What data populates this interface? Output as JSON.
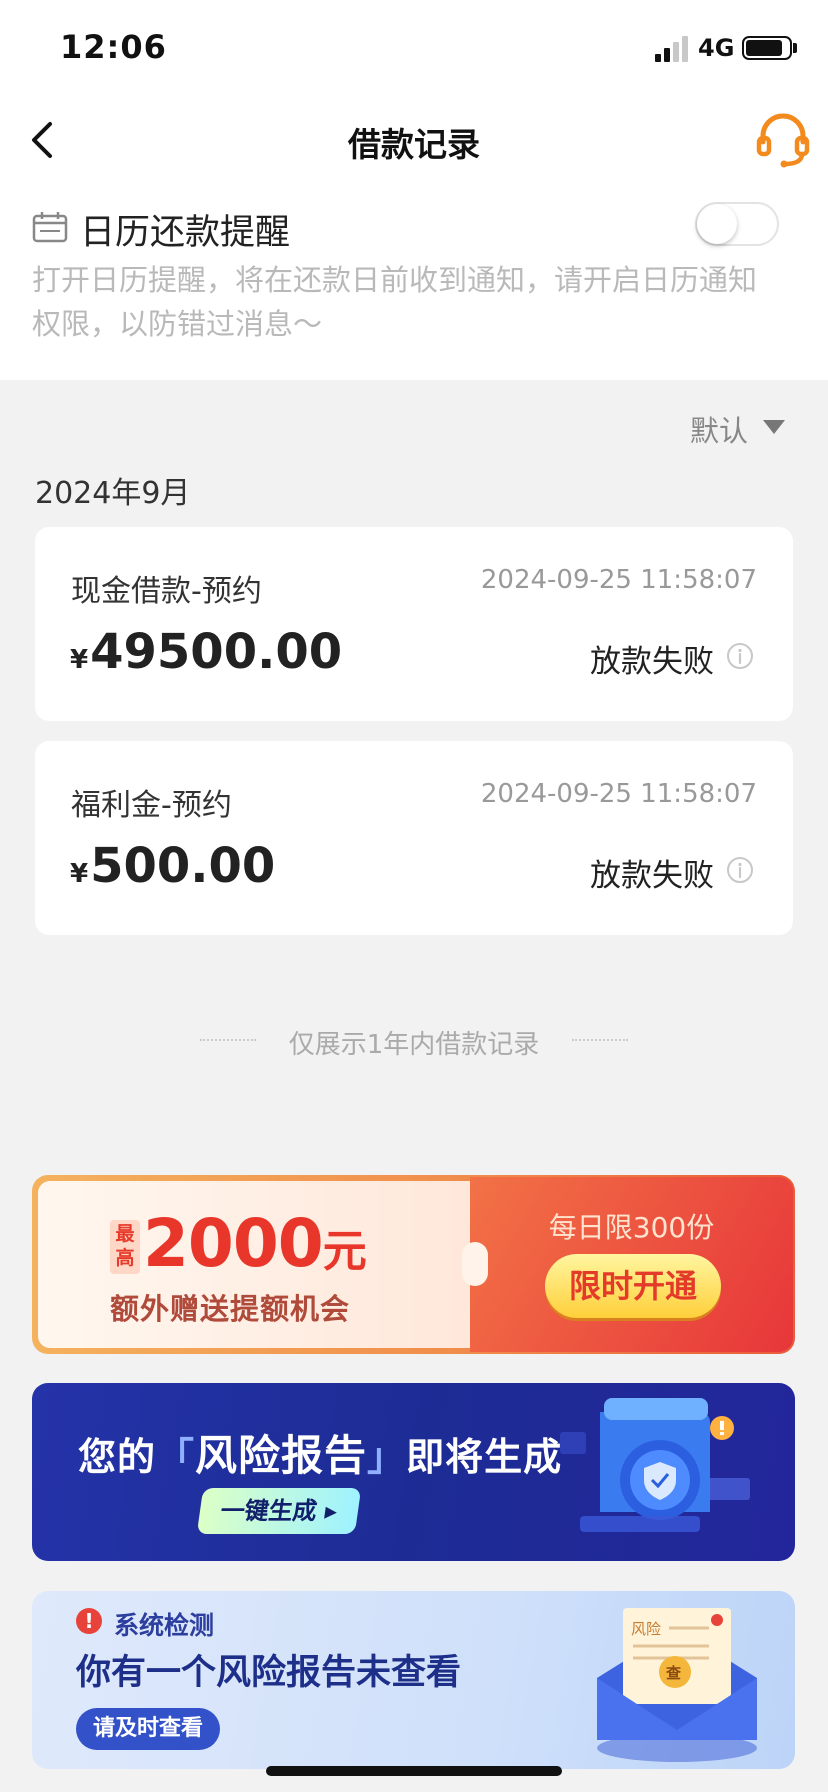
{
  "status_bar": {
    "time": "12:06",
    "network": "4G"
  },
  "header": {
    "title": "借款记录"
  },
  "reminder": {
    "title": "日历还款提醒",
    "description": "打开日历提醒，将在还款日前收到通知，请开启日历通知权限，以防错过消息～",
    "toggle_on": false
  },
  "sort": {
    "label": "默认"
  },
  "month": "2024年9月",
  "records": [
    {
      "name": "现金借款-预约",
      "time": "2024-09-25 11:58:07",
      "currency": "¥",
      "amount": "49500.00",
      "status": "放款失败"
    },
    {
      "name": "福利金-预约",
      "time": "2024-09-25 11:58:07",
      "currency": "¥",
      "amount": "500.00",
      "status": "放款失败"
    }
  ],
  "footer_note": "仅展示1年内借款记录",
  "banner_quota": {
    "tag": "最高",
    "amount": "2000",
    "unit": "元",
    "subtitle": "额外赠送提额机会",
    "limit": "每日限300份",
    "button": "限时开通"
  },
  "banner_report": {
    "title_prefix": "您的",
    "title_highlight": "风险报告",
    "title_suffix": "即将生成",
    "button": "一键生成 ▸"
  },
  "banner_check": {
    "subtitle": "系统检测",
    "title": "你有一个风险报告未查看",
    "button": "请及时查看",
    "illustration_label": "风险",
    "illustration_badge": "查"
  },
  "colors": {
    "accent_orange": "#f28a1d",
    "danger_red": "#e8372a",
    "report_blue": "#1d2c95"
  }
}
